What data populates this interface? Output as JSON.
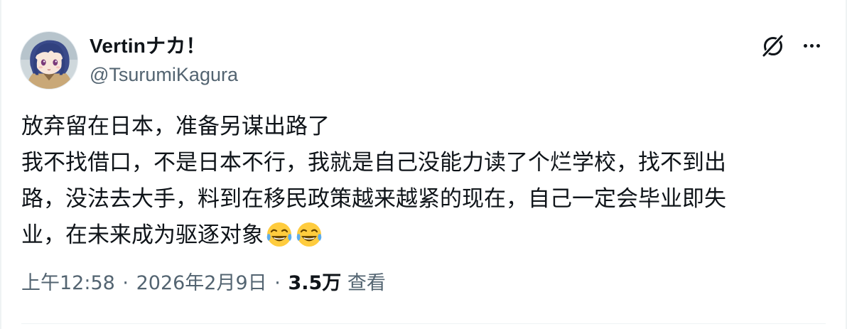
{
  "user": {
    "display_name": "Vertinナカ！",
    "handle": "@TsurumiKagura",
    "avatar_icon": "anime-girl-avatar"
  },
  "actions": {
    "grok_icon": "grok-icon",
    "more_icon": "more-icon"
  },
  "tweet": {
    "lines": [
      "放弃留在日本，准备另谋出路了",
      "我不找借口，不是日本不行，我就是自己没能力读了个烂学校，找不到出",
      "路，没法去大手，料到在移民政策越来越紧的现在，自己一定会毕业即失",
      "业，在未来成为驱逐对象"
    ],
    "emoji": [
      "face-with-tears-of-joy",
      "face-with-tears-of-joy"
    ]
  },
  "meta": {
    "time": "上午12:58",
    "separator": "·",
    "date": "2026年2月9日",
    "views_count": "3.5万",
    "views_label": "查看"
  },
  "colors": {
    "text_primary": "#0f1419",
    "text_secondary": "#536471",
    "border": "#eff3f4"
  }
}
